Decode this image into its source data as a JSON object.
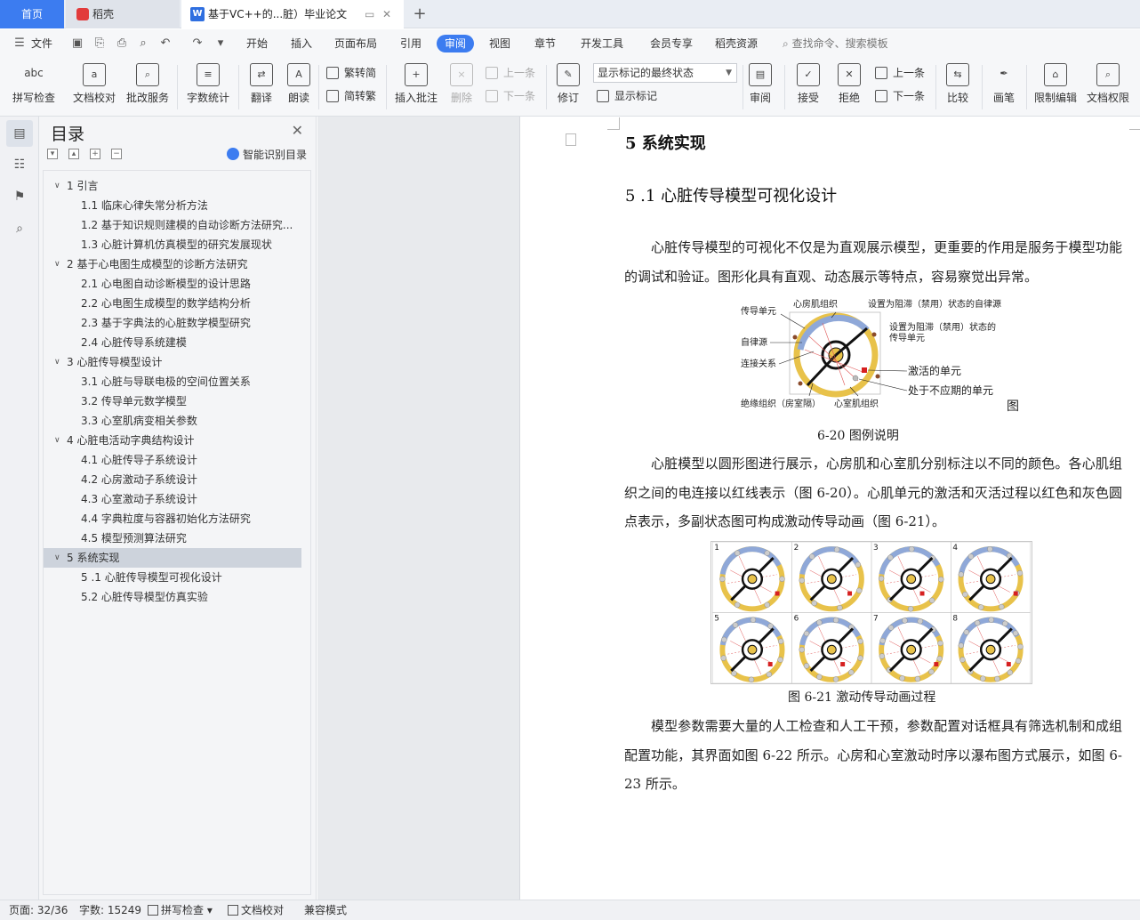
{
  "tabs": {
    "home": "首页",
    "daoke": "稻壳",
    "doc": "基于VC++的...脏）毕业论文",
    "add": "+"
  },
  "menu": {
    "file": "文件",
    "items": [
      "开始",
      "插入",
      "页面布局",
      "引用",
      "审阅",
      "视图",
      "章节",
      "开发工具",
      "会员专享",
      "稻壳资源"
    ],
    "active": "审阅",
    "search": "查找命令、搜索模板"
  },
  "ribbon": {
    "spell": "拼写检查",
    "proofread": "文档校对",
    "batch": "批改服务",
    "wordcount": "字数统计",
    "translate": "翻译",
    "read": "朗读",
    "to_trad": "繁转简",
    "to_simp": "简转繁",
    "insert_comment": "插入批注",
    "delete": "删除",
    "prev": "上一条",
    "next": "下一条",
    "revise": "修订",
    "markup_mode": "显示标记的最终状态",
    "show_markup": "显示标记",
    "review": "审阅",
    "accept": "接受",
    "reject": "拒绝",
    "prev2": "上一条",
    "next2": "下一条",
    "compare": "比较",
    "pen": "画笔",
    "restrict": "限制编辑",
    "doc_perm": "文档权限"
  },
  "toc": {
    "title": "目录",
    "smart": "智能识别目录",
    "items": [
      {
        "level": 1,
        "text": "1 引言"
      },
      {
        "level": 2,
        "text": "1.1 临床心律失常分析方法"
      },
      {
        "level": 2,
        "text": "1.2 基于知识规则建模的自动诊断方法研究..."
      },
      {
        "level": 2,
        "text": "1.3 心脏计算机仿真模型的研究发展现状"
      },
      {
        "level": 1,
        "text": "2 基于心电图生成模型的诊断方法研究"
      },
      {
        "level": 2,
        "text": "2.1 心电图自动诊断模型的设计思路"
      },
      {
        "level": 2,
        "text": "2.2 心电图生成模型的数学结构分析"
      },
      {
        "level": 2,
        "text": "2.3 基于字典法的心脏数学模型研究"
      },
      {
        "level": 2,
        "text": "2.4 心脏传导系统建模"
      },
      {
        "level": 1,
        "text": "3 心脏传导模型设计"
      },
      {
        "level": 2,
        "text": "3.1 心脏与导联电极的空间位置关系"
      },
      {
        "level": 2,
        "text": "3.2 传导单元数学模型"
      },
      {
        "level": 2,
        "text": "3.3 心室肌病变相关参数"
      },
      {
        "level": 1,
        "text": "4 心脏电活动字典结构设计"
      },
      {
        "level": 2,
        "text": "4.1 心脏传导子系统设计"
      },
      {
        "level": 2,
        "text": "4.2 心房激动子系统设计"
      },
      {
        "level": 2,
        "text": "4.3 心室激动子系统设计"
      },
      {
        "level": 2,
        "text": "4.4 字典粒度与容器初始化方法研究"
      },
      {
        "level": 2,
        "text": "4.5 模型预测算法研究"
      },
      {
        "level": 1,
        "text": "5 系统实现",
        "selected": true
      },
      {
        "level": 2,
        "text": "5 .1 心脏传导模型可视化设计"
      },
      {
        "level": 2,
        "text": "5.2 心脏传导模型仿真实验"
      }
    ]
  },
  "doc": {
    "h1": "5 系统实现",
    "h2": "5 .1 心脏传导模型可视化设计",
    "p1": "心脏传导模型的可视化不仅是为直观展示模型，更重要的作用是服务于模型功能的调试和验证。图形化具有直观、动态展示等特点，容易察觉出异常。",
    "fig1_labels": {
      "conduct_unit": "传导单元",
      "atrial": "心房肌组织",
      "blocked_src": "设置为阻滞（禁用）状态的自律源",
      "auto_src": "自律源",
      "blocked_unit_1": "设置为阻滞（禁用）状态的",
      "blocked_unit_2": "传导单元",
      "connection": "连接关系",
      "activated": "激活的单元",
      "refractory": "处于不应期的单元",
      "insulation": "绝缘组织（房室隔）",
      "ventricular": "心室肌组织",
      "tu": "图"
    },
    "cap1": "6-20 图例说明",
    "p2": "心脏模型以圆形图进行展示，心房肌和心室肌分别标注以不同的颜色。各心肌组织之间的电连接以红线表示（图 6-20）。心肌单元的激活和灭活过程以红色和灰色圆点表示，多副状态图可构成激动传导动画（图 6-21）。",
    "fig2_numbers": [
      "1",
      "2",
      "3",
      "4",
      "5",
      "6",
      "7",
      "8"
    ],
    "cap2": "图 6-21 激动传导动画过程",
    "p3": "模型参数需要大量的人工检查和人工干预，参数配置对话框具有筛选机制和成组配置功能，其界面如图 6-22 所示。心房和心室激动时序以瀑布图方式展示，如图 6-23 所示。"
  },
  "status": {
    "page": "页面: 32/36",
    "words": "字数: 15249",
    "spell": "拼写检查",
    "proof": "文档校对",
    "compat": "兼容模式"
  }
}
